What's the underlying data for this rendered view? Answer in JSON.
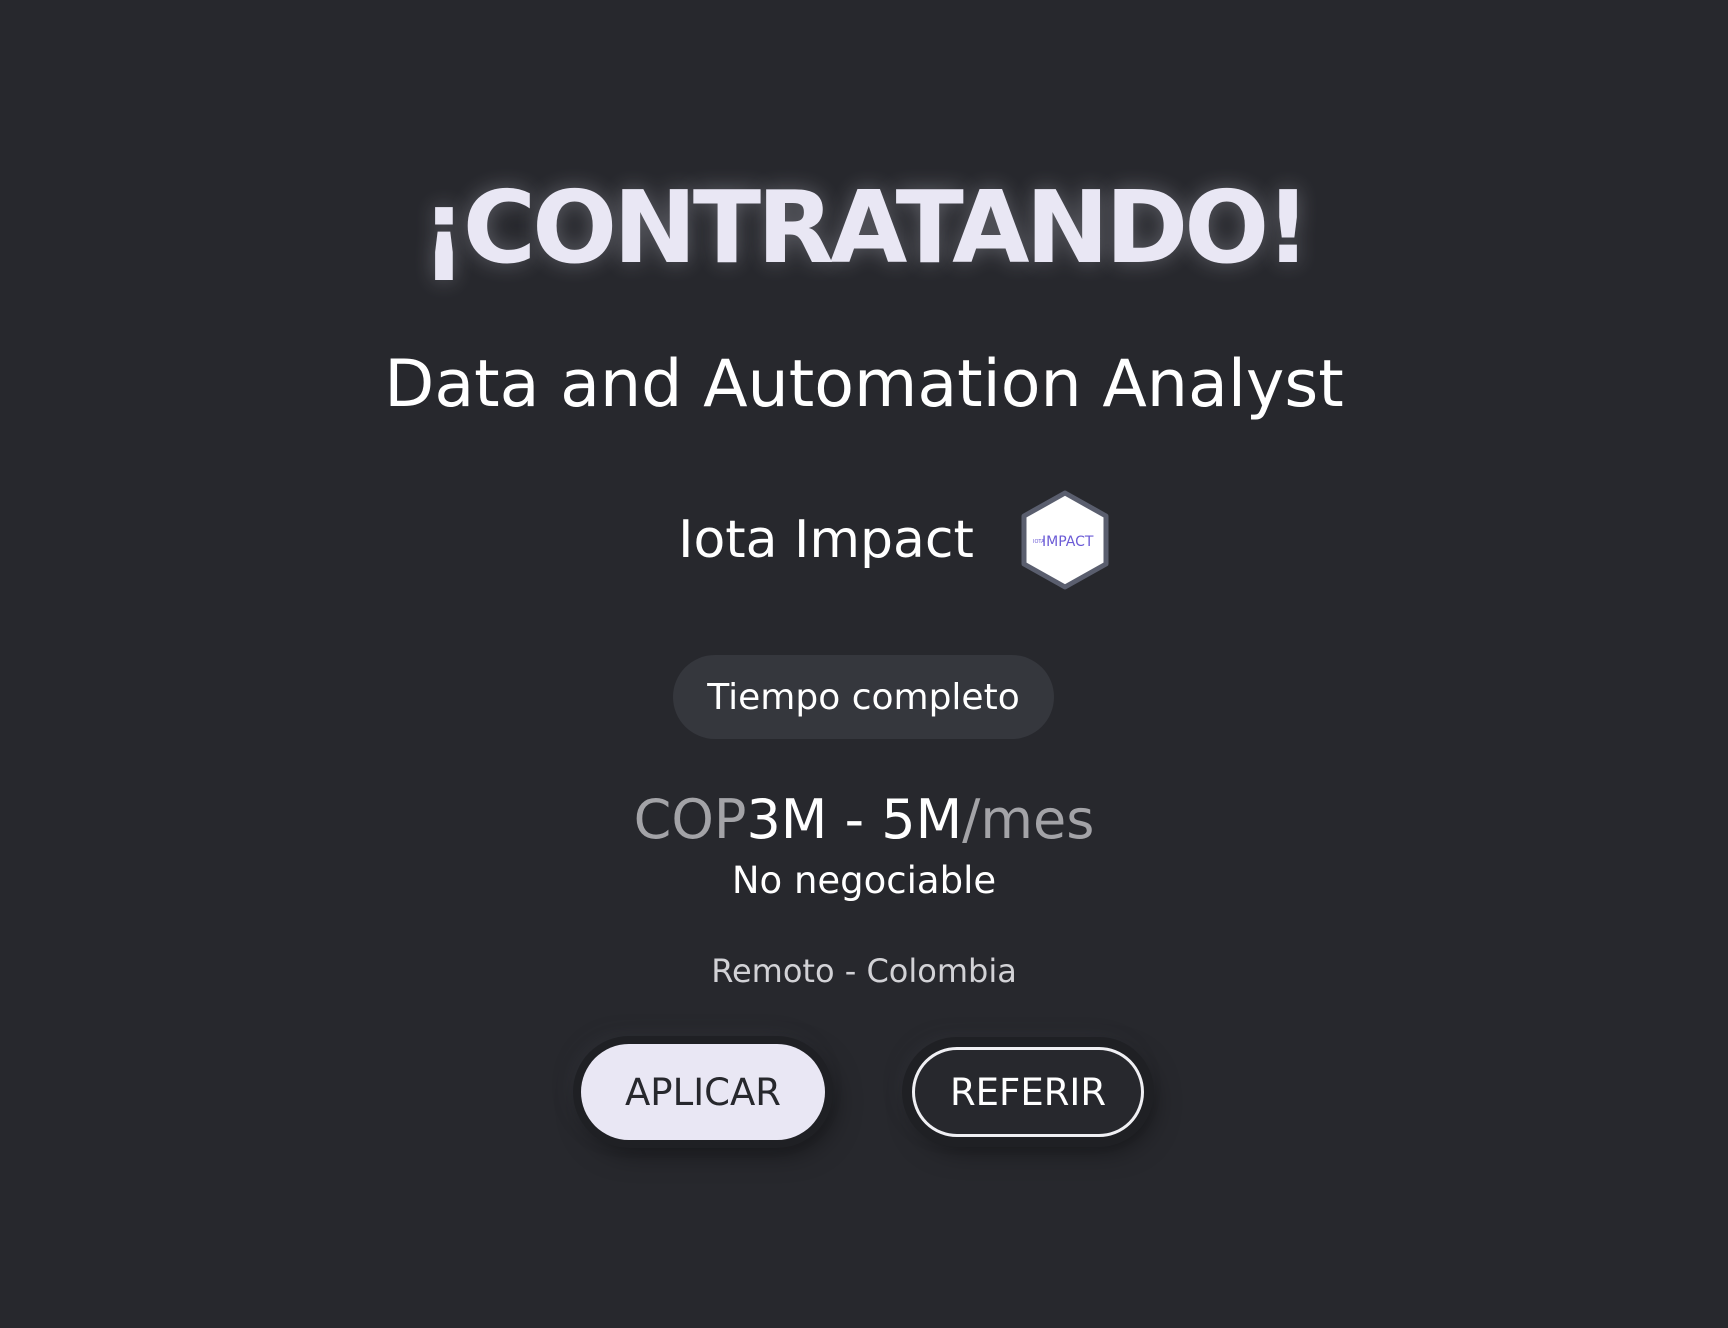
{
  "header": {
    "headline": "¡CONTRATANDO!",
    "job_title": "Data and Automation Analyst"
  },
  "company": {
    "name": "Iota Impact",
    "logo_text": "IMPACT",
    "logo_icon": "company-logo-icon"
  },
  "job": {
    "type_tag": "Tiempo completo",
    "salary_currency": "COP",
    "salary_range": "3M - 5M",
    "salary_unit": "/mes",
    "negotiable": "No negociable",
    "location": "Remoto - Colombia"
  },
  "actions": {
    "apply_label": "APLICAR",
    "refer_label": "REFERIR"
  },
  "colors": {
    "background": "#27282d",
    "headline": "#e9e7f4",
    "pill": "#35373d",
    "accent_purple": "#6b5bd6"
  }
}
